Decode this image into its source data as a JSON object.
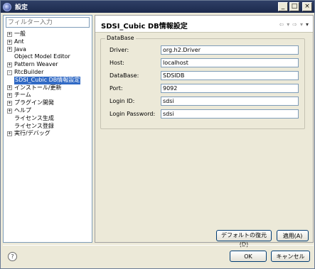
{
  "window": {
    "title": "設定",
    "minimize": "_",
    "maximize": "□",
    "close": "×"
  },
  "sidebar": {
    "filter_placeholder": "フィルター入力",
    "items": [
      {
        "label": "一般",
        "expander": "+"
      },
      {
        "label": "Ant",
        "expander": "+"
      },
      {
        "label": "Java",
        "expander": "+"
      },
      {
        "label": "Object Model Editor",
        "expander": ""
      },
      {
        "label": "Pattern Weaver",
        "expander": "+"
      },
      {
        "label": "RtcBuilder",
        "expander": "-"
      },
      {
        "label": "SDSI_Cubic DB情報設定",
        "expander": "",
        "selected": true
      },
      {
        "label": "インストール/更新",
        "expander": "+"
      },
      {
        "label": "チーム",
        "expander": "+"
      },
      {
        "label": "プラグイン開発",
        "expander": "+"
      },
      {
        "label": "ヘルプ",
        "expander": "+"
      },
      {
        "label": "ライセンス生成",
        "expander": ""
      },
      {
        "label": "ライセンス登録",
        "expander": ""
      },
      {
        "label": "実行/デバッグ",
        "expander": "+"
      }
    ]
  },
  "page": {
    "title": "SDSI_Cubic DB情報設定",
    "nav": {
      "back": "⇦",
      "back_menu": "▾",
      "forward": "⇨",
      "forward_menu": "▾",
      "menu": "▾"
    },
    "group_title": "DataBase",
    "fields": [
      {
        "label": "Driver:",
        "value": "org.h2.Driver"
      },
      {
        "label": "Host:",
        "value": "localhost"
      },
      {
        "label": "DataBase:",
        "value": "SDSIDB"
      },
      {
        "label": "Port:",
        "value": "9092"
      },
      {
        "label": "Login ID:",
        "value": "sdsi"
      },
      {
        "label": "Login Password:",
        "value": "sdsi"
      }
    ],
    "restore_defaults": "デフォルトの復元(D)",
    "apply": "適用(A)"
  },
  "footer": {
    "help": "?",
    "ok": "OK",
    "cancel": "キャンセル"
  },
  "colors": {
    "selection": "#316ac5",
    "titlebar": "#1c2a4d",
    "background": "#ece9d8"
  }
}
